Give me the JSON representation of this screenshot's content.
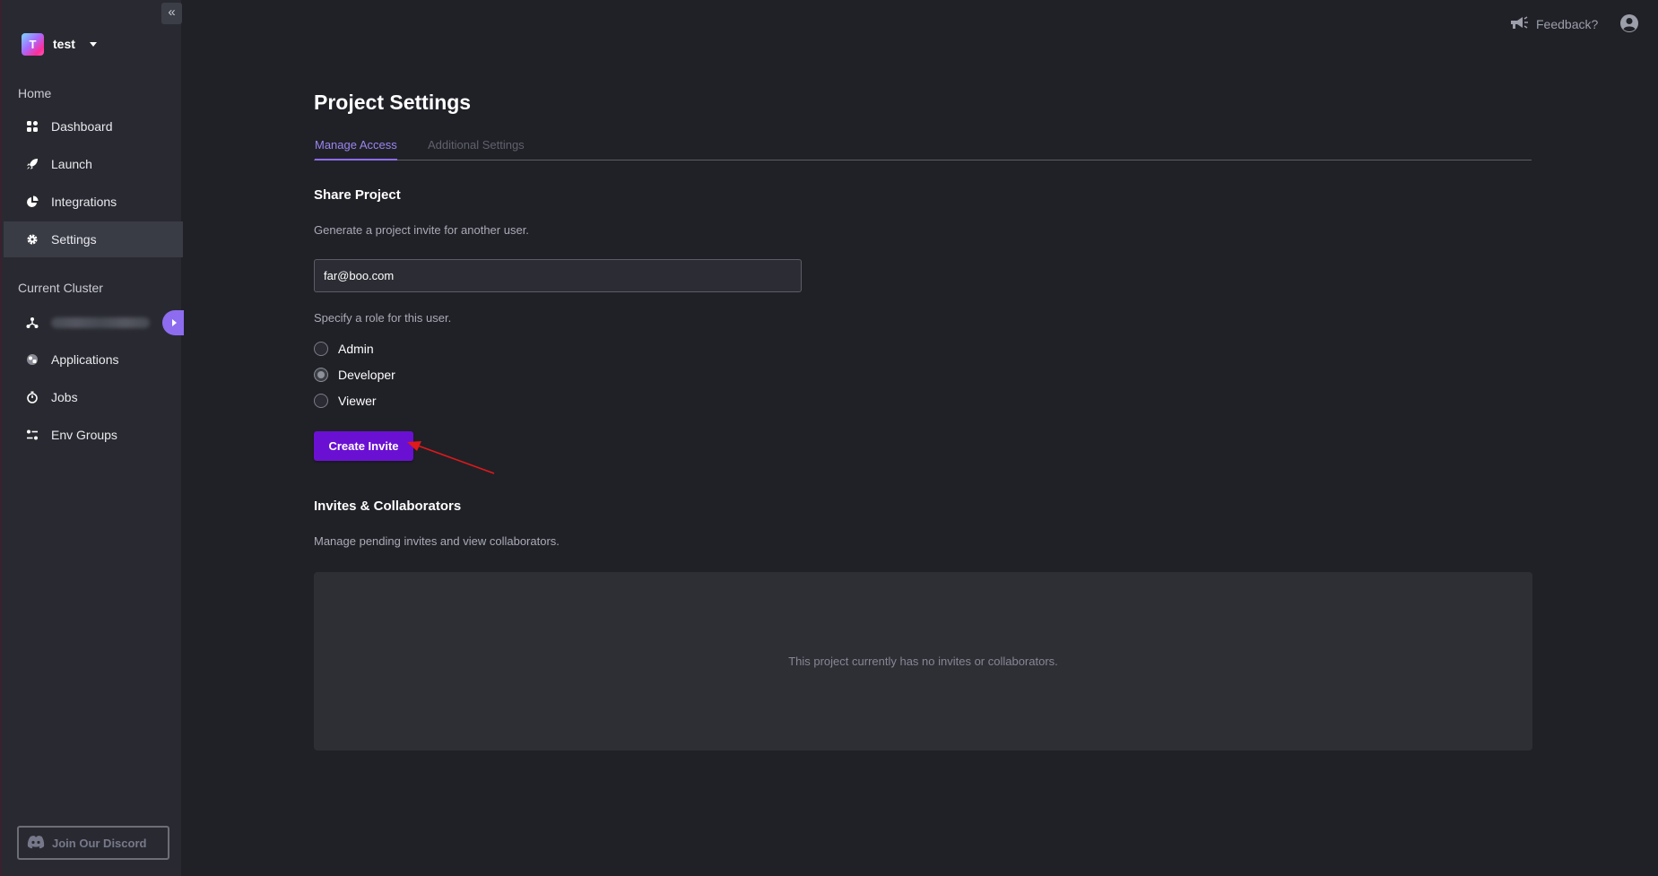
{
  "sidebar": {
    "collapse_glyph": "«",
    "project": {
      "logo_letter": "T",
      "name": "test"
    },
    "home_label": "Home",
    "home_items": [
      {
        "label": "Dashboard",
        "icon": "grid-icon"
      },
      {
        "label": "Launch",
        "icon": "rocket-icon"
      },
      {
        "label": "Integrations",
        "icon": "pie-chart-icon"
      },
      {
        "label": "Settings",
        "icon": "gear-icon",
        "active": true
      }
    ],
    "cluster_label": "Current Cluster",
    "cluster_items": [
      {
        "label": "Applications",
        "icon": "applications-icon"
      },
      {
        "label": "Jobs",
        "icon": "stopwatch-icon"
      },
      {
        "label": "Env Groups",
        "icon": "env-groups-icon"
      }
    ],
    "discord_label": "Join Our Discord"
  },
  "topbar": {
    "feedback_label": "Feedback?"
  },
  "main": {
    "title": "Project Settings",
    "tabs": [
      {
        "label": "Manage Access",
        "active": true
      },
      {
        "label": "Additional Settings",
        "active": false
      }
    ],
    "share": {
      "heading": "Share Project",
      "description": "Generate a project invite for another user.",
      "email_value": "far@boo.com",
      "role_prompt": "Specify a role for this user.",
      "roles": [
        {
          "label": "Admin",
          "checked": false
        },
        {
          "label": "Developer",
          "checked": true
        },
        {
          "label": "Viewer",
          "checked": false
        }
      ],
      "create_button": "Create Invite"
    },
    "collaborators": {
      "heading": "Invites & Collaborators",
      "description": "Manage pending invites and view collaborators.",
      "empty_text": "This project currently has no invites or collaborators."
    }
  },
  "colors": {
    "accent": "#8d6cf0",
    "primary_button": "#6a10d2",
    "annotation_arrow": "#e0191b"
  }
}
